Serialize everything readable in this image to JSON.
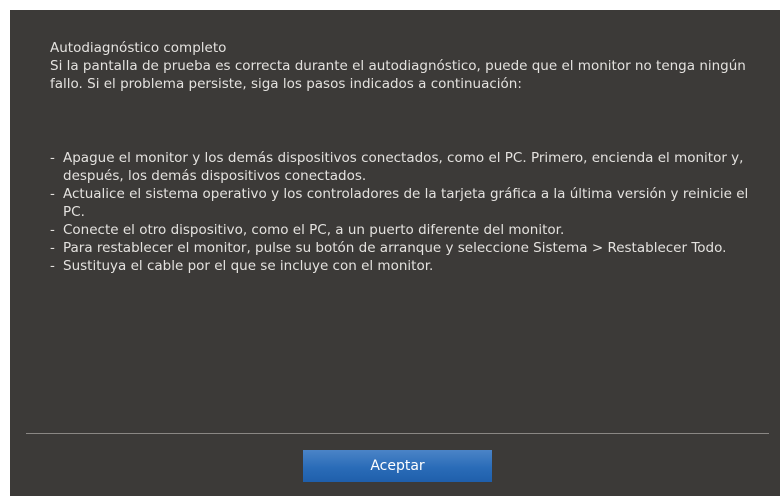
{
  "dialog": {
    "title": "Autodiagnóstico completo",
    "intro": "Si la pantalla de prueba es correcta durante el autodiagnóstico, puede que el monitor no tenga ningún fallo. Si el problema persiste, siga los pasos indicados a continuación:",
    "bullet": "-",
    "steps": [
      "Apague el monitor y los demás dispositivos conectados, como el PC.  Primero, encienda el monitor y, después, los demás dispositivos conectados.",
      "Actualice el sistema operativo y los controladores de la tarjeta gráfica a la última versión y reinicie el PC.",
      "Conecte el otro dispositivo, como el PC, a un puerto diferente del monitor.",
      "Para restablecer el monitor, pulse su botón de arranque y seleccione Sistema > Restablecer Todo.",
      "Sustituya el cable por el que se incluye con el monitor."
    ],
    "accept_label": "Aceptar"
  },
  "colors": {
    "background": "#3c3a38",
    "text": "#e4e2df",
    "button": "#2a6cb8",
    "divider": "#8a8784"
  }
}
